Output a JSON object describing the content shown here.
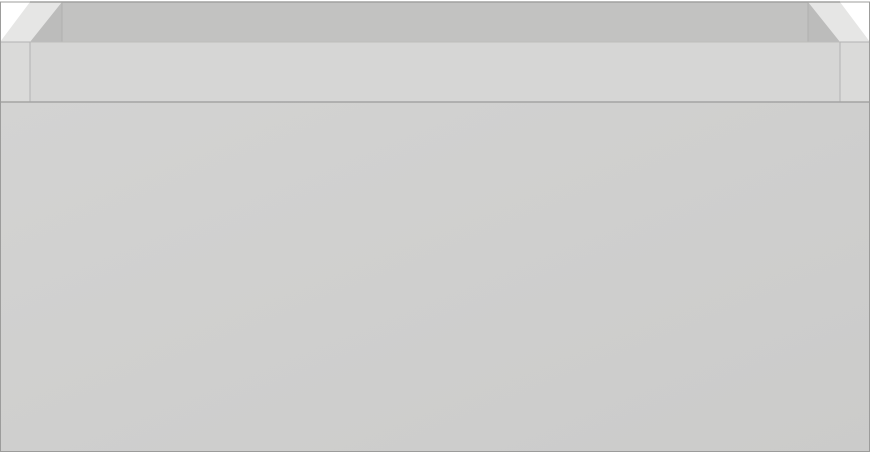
{
  "scene": {
    "subject": "drawer-cabinet",
    "colors": {
      "background": "#ffffff",
      "front_panel": "#cfcfce",
      "front_panel_light": "#d4d4d3",
      "rim_top": "#e8e8e7",
      "inner_wall": "#b9b9b8",
      "inner_back": "#c4c4c3",
      "side_panel": "#d7d7d6",
      "edge_line": "#a9a9a8",
      "outline": "#9c9c9b"
    }
  }
}
